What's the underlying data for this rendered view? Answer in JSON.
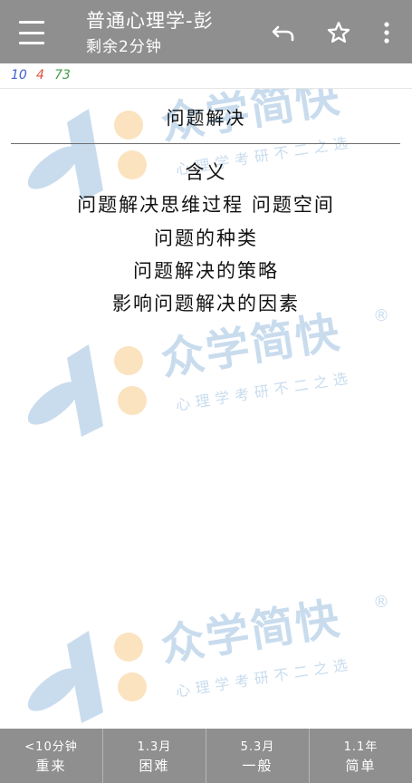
{
  "header": {
    "title": "普通心理学-彭",
    "subtitle": "剩余2分钟",
    "menu_icon": "hamburger-icon",
    "undo_icon": "undo-icon",
    "star_icon": "star-outline-icon",
    "more_icon": "more-vertical-icon"
  },
  "counts": {
    "new": "10",
    "learning": "4",
    "review": "73",
    "colors": {
      "new": "#3d5fd6",
      "learning": "#e0523b",
      "review": "#3e9e45"
    }
  },
  "watermark": {
    "brand": "众学简快",
    "slogan": "心理学考研不二之选",
    "registered": "®"
  },
  "card": {
    "question": "问题解决",
    "answer_lines": [
      "含义",
      "问题解决思维过程 问题空间",
      "问题的种类",
      "问题解决的策略",
      "影响问题解决的因素"
    ]
  },
  "answer_buttons": [
    {
      "time": "<10分钟",
      "label": "重来"
    },
    {
      "time": "1.3月",
      "label": "困难"
    },
    {
      "time": "5.3月",
      "label": "一般"
    },
    {
      "time": "1.1年",
      "label": "简单"
    }
  ],
  "colors": {
    "toolbar": "#8f8f8f",
    "watermark": "#c9dcee",
    "watermark_logo_orange": "#fbe3bf"
  }
}
